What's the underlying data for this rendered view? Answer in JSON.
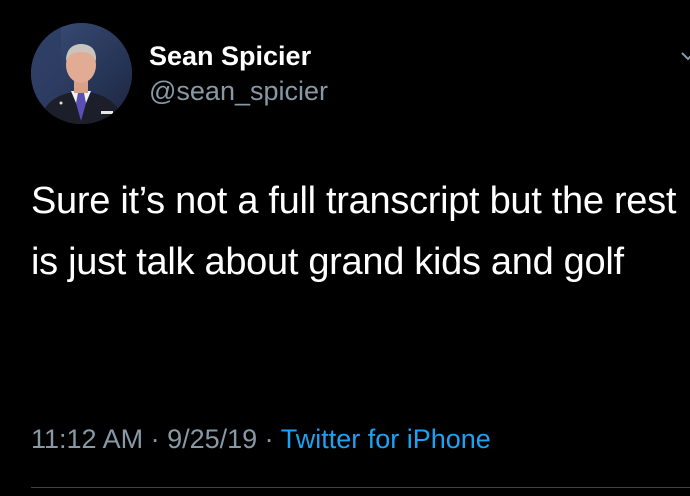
{
  "tweet": {
    "author": {
      "name": "Sean Spicier",
      "handle": "@sean_spicier",
      "avatar_icon": "profile-photo"
    },
    "text": "Sure it’s not a full transcript but the rest is just talk about grand kids and golf",
    "meta": {
      "time": "11:12 AM",
      "separator": " · ",
      "date": "9/25/19",
      "source": "Twitter for iPhone"
    }
  },
  "colors": {
    "background": "#000000",
    "text": "#ffffff",
    "secondary_text": "#8899a6",
    "link": "#1da1f2",
    "divider": "#38444d"
  }
}
